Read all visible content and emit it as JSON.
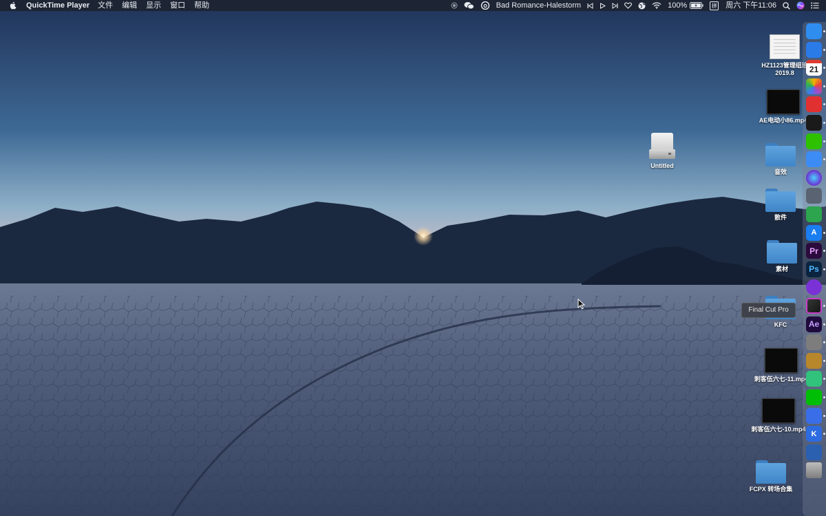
{
  "menubar": {
    "app_name": "QuickTime Player",
    "menus": [
      "文件",
      "编辑",
      "显示",
      "窗口",
      "帮助"
    ],
    "now_playing": "Bad Romance-Halestorm",
    "battery_percent": "100%",
    "input_method": "拼",
    "clock": "周六 下午11:06"
  },
  "desktop": {
    "items": [
      {
        "name": "HZ1123管理组班",
        "name2": "2019.8",
        "kind": "document"
      },
      {
        "name": "AE电动小86.mp4",
        "kind": "video"
      },
      {
        "name": "Untitled",
        "kind": "drive"
      },
      {
        "name": "音效",
        "kind": "folder"
      },
      {
        "name": "散件",
        "kind": "folder"
      },
      {
        "name": "素材",
        "kind": "folder"
      },
      {
        "name": "KFC",
        "kind": "folder"
      },
      {
        "name": "刺客伍六七-11.mp4",
        "kind": "video"
      },
      {
        "name": "刺客伍六七-10.mp4",
        "kind": "video"
      },
      {
        "name": "FCPX 转场合集",
        "kind": "folder"
      }
    ]
  },
  "dock": {
    "tooltip": "Final Cut Pro",
    "apps": [
      {
        "icon": "finder-icon",
        "color": "#2f8df0",
        "label": ""
      },
      {
        "icon": "safari-icon",
        "color": "#2a7be8",
        "label": ""
      },
      {
        "icon": "calendar-icon",
        "color": "#ffffff",
        "label": "21"
      },
      {
        "icon": "photos-icon",
        "color": "#f4b400",
        "label": ""
      },
      {
        "icon": "netease-music-icon",
        "color": "#e03030",
        "label": ""
      },
      {
        "icon": "qq-icon",
        "color": "#1a1a1a",
        "label": ""
      },
      {
        "icon": "wechat-icon",
        "color": "#2dc100",
        "label": ""
      },
      {
        "icon": "baidu-netdisk-icon",
        "color": "#3d8cf5",
        "label": ""
      },
      {
        "icon": "siri-icon",
        "color": "#6b2fd1",
        "label": ""
      },
      {
        "icon": "launchpad-icon",
        "color": "#5a6372",
        "label": ""
      },
      {
        "icon": "numbers-icon",
        "color": "#2da44e",
        "label": ""
      },
      {
        "icon": "app-store-icon",
        "color": "#1a7df0",
        "label": "A"
      },
      {
        "icon": "premiere-icon",
        "color": "#2b0a3d",
        "label": "Pr"
      },
      {
        "icon": "photoshop-icon",
        "color": "#0b2440",
        "label": "Ps"
      },
      {
        "icon": "imovie-icon",
        "color": "#7a32d6",
        "label": ""
      },
      {
        "icon": "final-cut-pro-icon",
        "color": "#222222",
        "label": ""
      },
      {
        "icon": "after-effects-icon",
        "color": "#1f0b3d",
        "label": "Ae"
      },
      {
        "icon": "system-preferences-icon",
        "color": "#7d7d7d",
        "label": ""
      },
      {
        "icon": "garageband-icon",
        "color": "#b8862b",
        "label": ""
      },
      {
        "icon": "qq-music-icon",
        "color": "#31c27c",
        "label": ""
      },
      {
        "icon": "iqiyi-icon",
        "color": "#00be06",
        "label": ""
      },
      {
        "icon": "feishu-icon",
        "color": "#3a6ee8",
        "label": ""
      },
      {
        "icon": "kuaikan-icon",
        "color": "#2d6be0",
        "label": "K"
      },
      {
        "icon": "browser-icon",
        "color": "#2b5fb0",
        "label": ""
      },
      {
        "icon": "trash-icon",
        "color": "#8c8c8c",
        "label": ""
      }
    ]
  },
  "colors": {
    "sky_top": "#1f3257",
    "sky_horizon": "#eacbc4",
    "mountains": "#1b2940",
    "playa": "#3e4d6e"
  }
}
